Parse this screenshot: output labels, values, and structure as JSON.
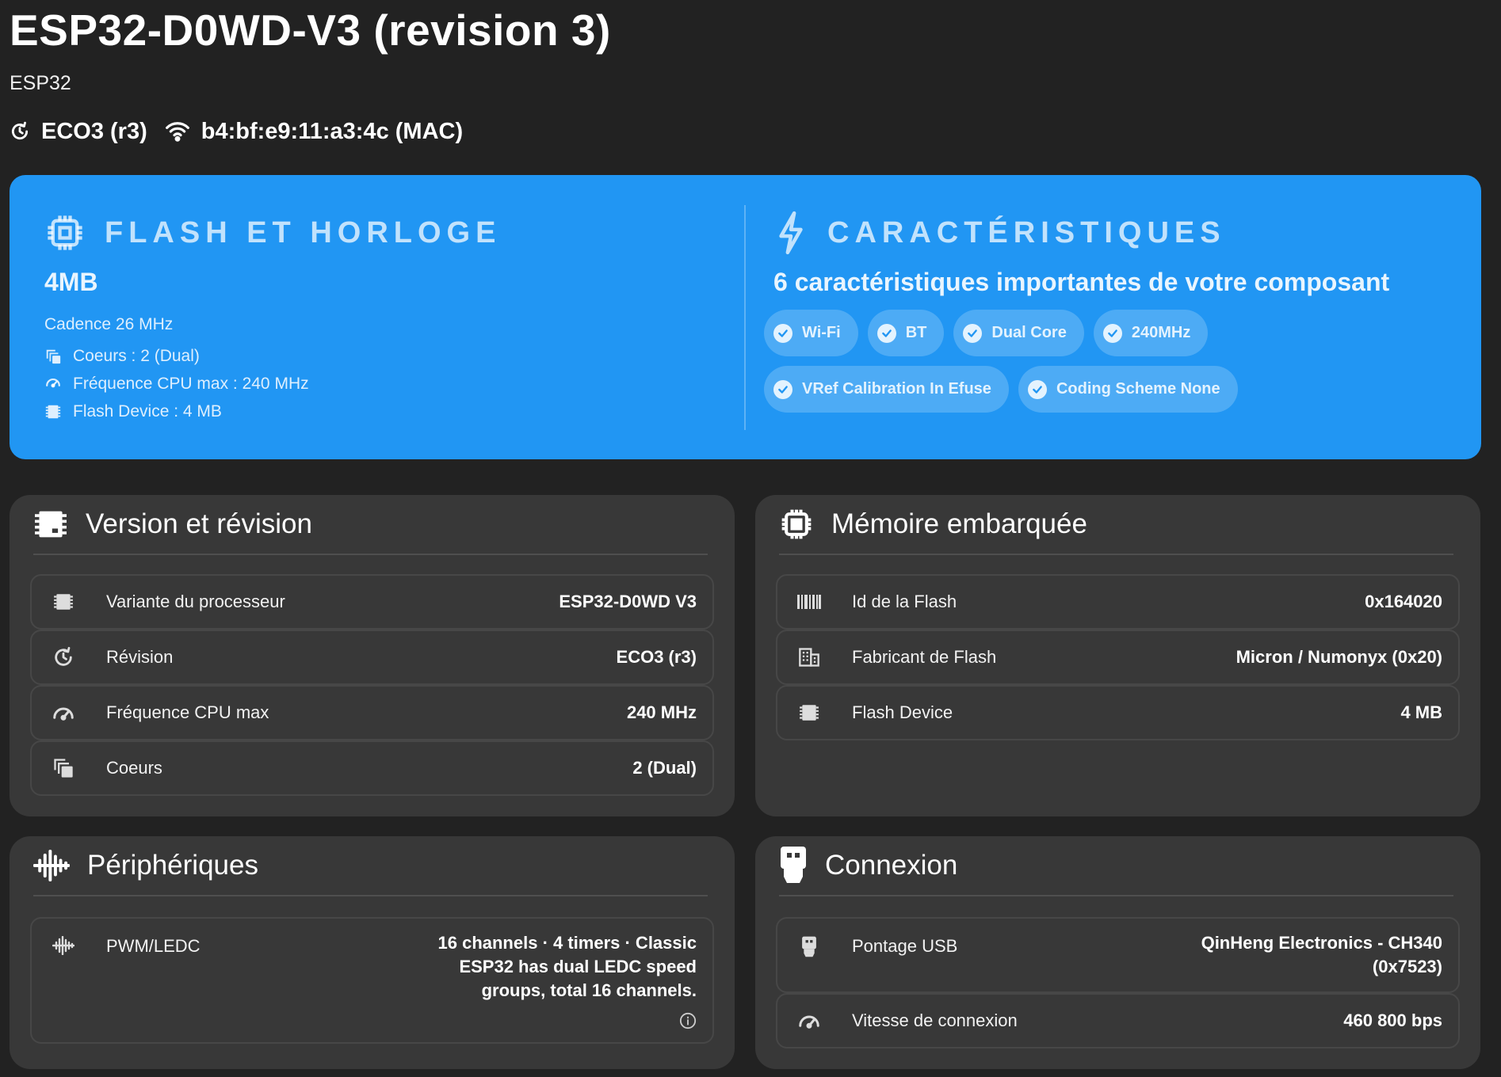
{
  "header": {
    "title": "ESP32-D0WD-V3 (revision 3)",
    "subtitle": "ESP32",
    "revision_badge": "ECO3 (r3)",
    "mac_badge": "b4:bf:e9:11:a3:4c (MAC)"
  },
  "hero": {
    "flash": {
      "heading": "FLASH ET HORLOGE",
      "value": "4MB",
      "subtitle": "Cadence 26 MHz",
      "items": [
        {
          "icon": "cores-icon",
          "text": "Coeurs : 2 (Dual)"
        },
        {
          "icon": "speedometer-icon",
          "text": "Fréquence CPU max : 240 MHz"
        },
        {
          "icon": "memory-chip-icon",
          "text": "Flash Device : 4 MB"
        }
      ]
    },
    "features": {
      "heading": "CARACTÉRISTIQUES",
      "summary": "6 caractéristiques importantes de votre composant",
      "chips": [
        "Wi-Fi",
        "BT",
        "Dual Core",
        "240MHz",
        "VRef Calibration In Efuse",
        "Coding Scheme None"
      ]
    }
  },
  "cards": {
    "version": {
      "title": "Version et révision",
      "icon": "memory-chip-icon",
      "rows": [
        {
          "icon": "memory-chip-icon",
          "label": "Variante du processeur",
          "value": "ESP32-D0WD V3"
        },
        {
          "icon": "revision-icon",
          "label": "Révision",
          "value": "ECO3 (r3)"
        },
        {
          "icon": "speedometer-icon",
          "label": "Fréquence CPU max",
          "value": "240 MHz"
        },
        {
          "icon": "cores-icon",
          "label": "Coeurs",
          "value": "2 (Dual)"
        }
      ]
    },
    "memory": {
      "title": "Mémoire embarquée",
      "icon": "cpu-icon",
      "rows": [
        {
          "icon": "barcode-icon",
          "label": "Id de la Flash",
          "value": "0x164020"
        },
        {
          "icon": "factory-icon",
          "label": "Fabricant de Flash",
          "value": "Micron / Numonyx (0x20)"
        },
        {
          "icon": "memory-chip-icon",
          "label": "Flash Device",
          "value": "4 MB"
        }
      ]
    },
    "peripherals": {
      "title": "Périphériques",
      "icon": "waveform-icon",
      "rows": [
        {
          "icon": "waveform-icon",
          "label": "PWM/LEDC",
          "value_lines": [
            "16 channels · 4 timers · Classic",
            "ESP32 has dual LEDC speed",
            "groups, total 16 channels."
          ]
        }
      ]
    },
    "connection": {
      "title": "Connexion",
      "icon": "usb-icon",
      "rows": [
        {
          "icon": "usb-icon",
          "label": "Pontage USB",
          "value_lines": [
            "QinHeng Electronics - CH340",
            "(0x7523)"
          ]
        },
        {
          "icon": "speedometer-icon",
          "label": "Vitesse de connexion",
          "value": "460 800 bps"
        }
      ]
    }
  },
  "colors": {
    "background": "#222222",
    "hero": "#2196f3",
    "card": "#383838",
    "row_border": "#474747"
  }
}
